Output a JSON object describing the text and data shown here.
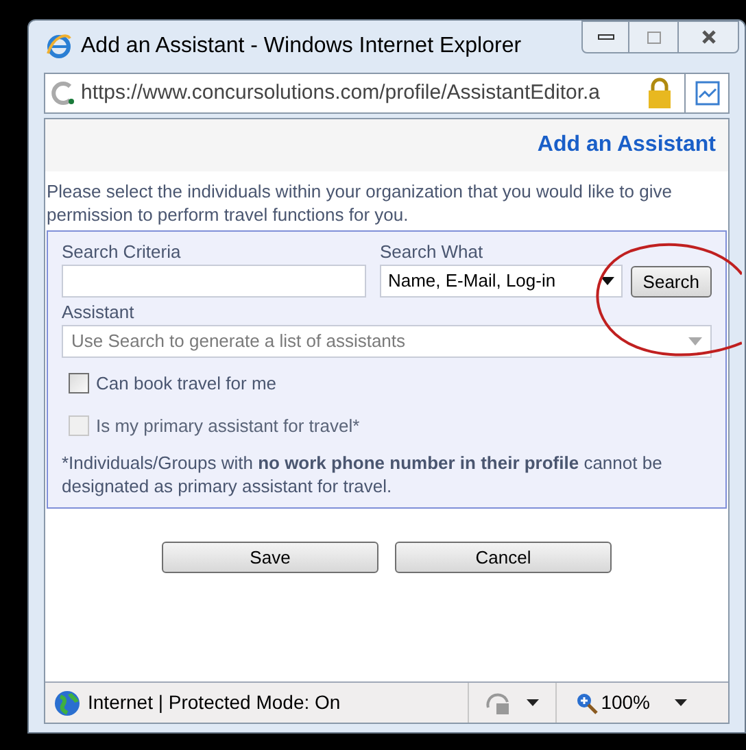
{
  "window": {
    "title": "Add an Assistant - Windows Internet Explorer"
  },
  "address_bar": {
    "url": "https://www.concursolutions.com/profile/AssistantEditor.a"
  },
  "page": {
    "heading": "Add an Assistant",
    "intro": "Please select the individuals within your organization that you would like to give permission to perform travel functions for you.",
    "search_criteria": {
      "label": "Search Criteria"
    },
    "search_what": {
      "label": "Search What",
      "value": "Name, E-Mail, Log-in"
    },
    "search_button": "Search",
    "assistant": {
      "label": "Assistant",
      "placeholder": "Use Search to generate a list of assistants"
    },
    "checkboxes": [
      {
        "label": "Can book travel for me",
        "checked": false,
        "disabled": false
      },
      {
        "label": "Is my primary assistant for travel*",
        "checked": false,
        "disabled": true
      }
    ],
    "note": "*Individuals/Groups with **no work phone number in their profile** cannot be designated as primary assistant for travel.",
    "buttons": [
      "Save",
      "Cancel"
    ]
  },
  "status_bar": {
    "zone": "Internet | Protected Mode: On",
    "zoom": "100%"
  }
}
